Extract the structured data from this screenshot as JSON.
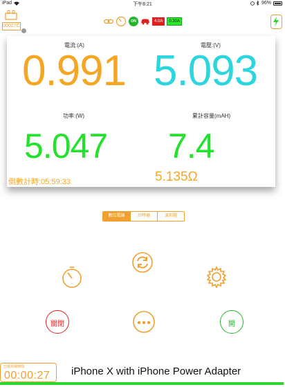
{
  "status_bar": {
    "device": "iPad",
    "time": "下午8:21",
    "battery": "96%"
  },
  "toolbar": {
    "device_code": "00027C",
    "on_label": "ON",
    "limit_low": "4.0A",
    "limit_high": "0.30A"
  },
  "readings": {
    "current_label": "電流:(A)",
    "current_value": "0.991",
    "voltage_label": "電壓:(V)",
    "voltage_value": "5.093",
    "power_label": "功率:(W)",
    "power_value": "5.047",
    "energy_label": "累計容量(mAH)",
    "energy_value": "7.4",
    "countdown": "倒數計時:05:59:33",
    "resistance": "5.135Ω"
  },
  "tabs": [
    "數位電錶",
    "計時器",
    "波形圖"
  ],
  "controls": {
    "off_label": "關閉",
    "on_label": "開"
  },
  "bottom": {
    "elapsed_label": "已經充電時間",
    "elapsed_value": "00:00:27",
    "caption": "iPhone X with iPhone Power Adapter",
    "progress_fraction": 0.995
  },
  "colors": {
    "accent": "#f0a030",
    "current": "#f5a623",
    "voltage": "#2dd6de",
    "power": "#23e12d",
    "off": "#e02020",
    "on": "#25b52a"
  }
}
